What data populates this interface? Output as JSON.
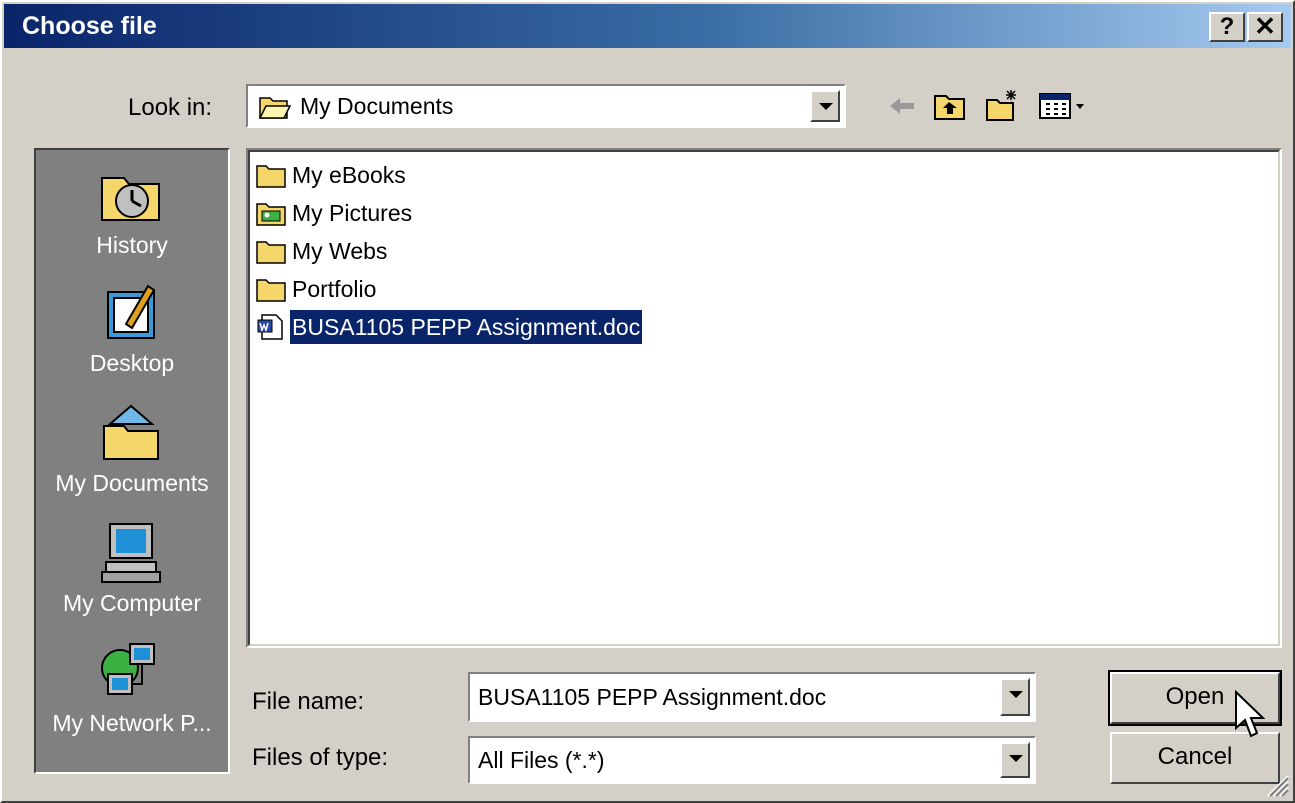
{
  "window": {
    "title": "Choose file",
    "help_label": "?",
    "close_label": "✕"
  },
  "look_in": {
    "label": "Look in:",
    "value": "My Documents"
  },
  "toolbar": {
    "icons": [
      "back-arrow-icon",
      "up-one-level-icon",
      "new-folder-icon",
      "views-menu-icon"
    ]
  },
  "places": [
    {
      "label": "History",
      "icon": "history-icon"
    },
    {
      "label": "Desktop",
      "icon": "desktop-icon"
    },
    {
      "label": "My Documents",
      "icon": "my-documents-icon"
    },
    {
      "label": "My Computer",
      "icon": "my-computer-icon"
    },
    {
      "label": "My Network P...",
      "icon": "my-network-places-icon"
    }
  ],
  "files": [
    {
      "name": "My eBooks",
      "icon": "folder-icon",
      "selected": false
    },
    {
      "name": "My Pictures",
      "icon": "pictures-folder-icon",
      "selected": false
    },
    {
      "name": "My Webs",
      "icon": "folder-icon",
      "selected": false
    },
    {
      "name": "Portfolio",
      "icon": "folder-icon",
      "selected": false
    },
    {
      "name": "BUSA1105 PEPP Assignment.doc",
      "icon": "word-document-icon",
      "selected": true
    }
  ],
  "file_name": {
    "label": "File name:",
    "value": "BUSA1105 PEPP Assignment.doc"
  },
  "file_type": {
    "label": "Files of type:",
    "value": "All Files (*.*)"
  },
  "buttons": {
    "open": "Open",
    "cancel": "Cancel"
  },
  "colors": {
    "face": "#d4d0c8",
    "selection": "#0a246a",
    "title_start": "#0a246a",
    "title_end": "#a6caf0"
  }
}
